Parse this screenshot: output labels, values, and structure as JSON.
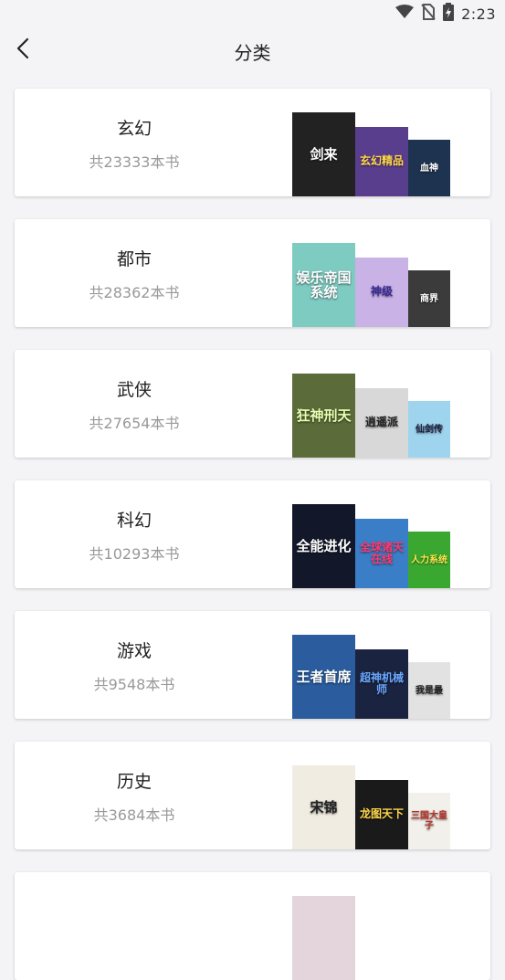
{
  "status_bar": {
    "time": "2:23",
    "icons": [
      "wifi-icon",
      "no-sim-icon",
      "battery-charging-icon"
    ]
  },
  "header": {
    "title": "分类",
    "back_icon": "chevron-left-icon"
  },
  "categories": [
    {
      "name": "玄幻",
      "count": "共23333本书",
      "covers": [
        {
          "title": "剑来",
          "bg": "#222222",
          "fg": "#ffffff"
        },
        {
          "title": "玄幻精品",
          "bg": "#5a3e8e",
          "fg": "#ffd84a"
        },
        {
          "title": "血神",
          "bg": "#1e3350",
          "fg": "#ffffff"
        }
      ]
    },
    {
      "name": "都市",
      "count": "共28362本书",
      "covers": [
        {
          "title": "娱乐帝国系统",
          "bg": "#7ecbc2",
          "fg": "#ffffff"
        },
        {
          "title": "神级",
          "bg": "#c8b2e6",
          "fg": "#3a2a9a"
        },
        {
          "title": "商界",
          "bg": "#3b3b3b",
          "fg": "#ffffff"
        }
      ]
    },
    {
      "name": "武侠",
      "count": "共27654本书",
      "covers": [
        {
          "title": "狂神刑天",
          "bg": "#5c6b3a",
          "fg": "#e8ffb0"
        },
        {
          "title": "逍遥派",
          "bg": "#d8d8d8",
          "fg": "#222222"
        },
        {
          "title": "仙剑传",
          "bg": "#9ed4ee",
          "fg": "#1a1a3a"
        }
      ]
    },
    {
      "name": "科幻",
      "count": "共10293本书",
      "covers": [
        {
          "title": "全能进化",
          "bg": "#12182a",
          "fg": "#ffffff"
        },
        {
          "title": "全球诸天在线",
          "bg": "#3a7ec8",
          "fg": "#ff3a6e"
        },
        {
          "title": "人力系统",
          "bg": "#3aa830",
          "fg": "#ffe84a"
        }
      ]
    },
    {
      "name": "游戏",
      "count": "共9548本书",
      "covers": [
        {
          "title": "王者首席",
          "bg": "#2a5c9e",
          "fg": "#ffffff"
        },
        {
          "title": "超神机械师",
          "bg": "#1a2340",
          "fg": "#6aa8ff"
        },
        {
          "title": "我是最",
          "bg": "#e2e2e2",
          "fg": "#222222"
        }
      ]
    },
    {
      "name": "历史",
      "count": "共3684本书",
      "covers": [
        {
          "title": "宋锦",
          "bg": "#f0ece2",
          "fg": "#222222"
        },
        {
          "title": "龙图天下",
          "bg": "#1a1a1a",
          "fg": "#ffd84a"
        },
        {
          "title": "三国大皇子",
          "bg": "#f2f0ea",
          "fg": "#b8342a"
        }
      ]
    },
    {
      "name": "",
      "count": "",
      "covers": [
        {
          "title": "",
          "bg": "#e4d4dc",
          "fg": "#ffffff"
        },
        {
          "title": "",
          "bg": "#ffffff",
          "fg": "#ffffff"
        },
        {
          "title": "",
          "bg": "#ffffff",
          "fg": "#ffffff"
        }
      ]
    }
  ]
}
